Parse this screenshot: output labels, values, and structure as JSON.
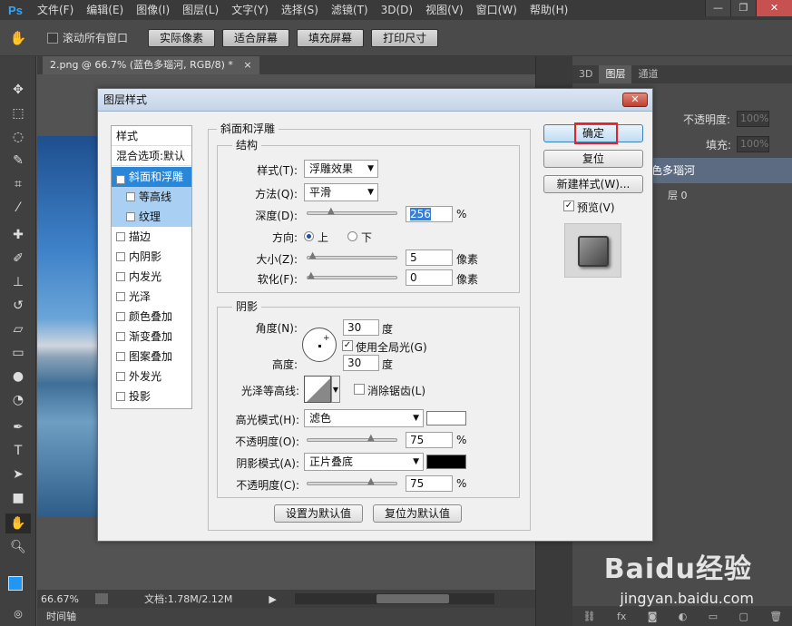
{
  "app": {
    "logo": "Ps",
    "menu": [
      "文件(F)",
      "编辑(E)",
      "图像(I)",
      "图层(L)",
      "文字(Y)",
      "选择(S)",
      "滤镜(T)",
      "3D(D)",
      "视图(V)",
      "窗口(W)",
      "帮助(H)"
    ],
    "window_controls": [
      "—",
      "❐",
      "✕"
    ]
  },
  "options_bar": {
    "scroll_all_label": "滚动所有窗口",
    "buttons": [
      "实际像素",
      "适合屏幕",
      "填充屏幕",
      "打印尺寸"
    ]
  },
  "document": {
    "tab_title": "2.png @ 66.7% (蓝色多瑙河, RGB/8) *",
    "tab_close": "×"
  },
  "status": {
    "zoom": "66.67%",
    "doc_size": "文档:1.78M/2.12M",
    "timeline": "时间轴"
  },
  "layers_panel": {
    "tabs": [
      "3D",
      "图层",
      "通道"
    ],
    "opacity_label": "不透明度:",
    "opacity_value": "100%",
    "fill_label": "填充:",
    "fill_value": "100%",
    "layer_name": "色多瑙河",
    "layer2_name": "层 0"
  },
  "dialog": {
    "title": "图层样式",
    "close": "✕",
    "styles_header": "样式",
    "blend_options": "混合选项:默认",
    "styles": [
      {
        "label": "斜面和浮雕",
        "checked": true
      },
      {
        "label": "等高线",
        "checked": false
      },
      {
        "label": "纹理",
        "checked": false
      },
      {
        "label": "描边",
        "checked": false
      },
      {
        "label": "内阴影",
        "checked": false
      },
      {
        "label": "内发光",
        "checked": false
      },
      {
        "label": "光泽",
        "checked": false
      },
      {
        "label": "颜色叠加",
        "checked": false
      },
      {
        "label": "渐变叠加",
        "checked": false
      },
      {
        "label": "图案叠加",
        "checked": false
      },
      {
        "label": "外发光",
        "checked": false
      },
      {
        "label": "投影",
        "checked": false
      }
    ],
    "bevel": {
      "group_title": "斜面和浮雕",
      "structure_title": "结构",
      "style_label": "样式(T):",
      "style_value": "浮雕效果",
      "technique_label": "方法(Q):",
      "technique_value": "平滑",
      "depth_label": "深度(D):",
      "depth_value": "256",
      "depth_unit": "%",
      "depth_level": 0.25,
      "direction_label": "方向:",
      "direction_up": "上",
      "direction_down": "下",
      "size_label": "大小(Z):",
      "size_value": "5",
      "size_unit": "像素",
      "size_level": 0.02,
      "soften_label": "软化(F):",
      "soften_value": "0",
      "soften_unit": "像素",
      "soften_level": 0.0
    },
    "shading": {
      "group_title": "阴影",
      "angle_label": "角度(N):",
      "angle_value": "30",
      "angle_unit": "度",
      "global_light_label": "使用全局光(G)",
      "global_light_checked": true,
      "altitude_label": "高度:",
      "altitude_value": "30",
      "altitude_unit": "度",
      "gloss_label": "光泽等高线:",
      "antialias_label": "消除锯齿(L)",
      "antialias_checked": false,
      "highlight_mode_label": "高光模式(H):",
      "highlight_mode_value": "滤色",
      "highlight_color": "#ffffff",
      "highlight_opacity_label": "不透明度(O):",
      "highlight_opacity_value": "75",
      "highlight_opacity_unit": "%",
      "highlight_opacity_level": 0.75,
      "shadow_mode_label": "阴影模式(A):",
      "shadow_mode_value": "正片叠底",
      "shadow_color": "#000000",
      "shadow_opacity_label": "不透明度(C):",
      "shadow_opacity_value": "75",
      "shadow_opacity_unit": "%",
      "shadow_opacity_level": 0.75
    },
    "bottom_buttons": [
      "设置为默认值",
      "复位为默认值"
    ],
    "right_buttons": {
      "ok": "确定",
      "reset": "复位",
      "new_style": "新建样式(W)...",
      "preview_label": "预览(V)",
      "preview_checked": true
    }
  },
  "watermark": {
    "logo": "Baidu经验",
    "url": "jingyan.baidu.com"
  }
}
